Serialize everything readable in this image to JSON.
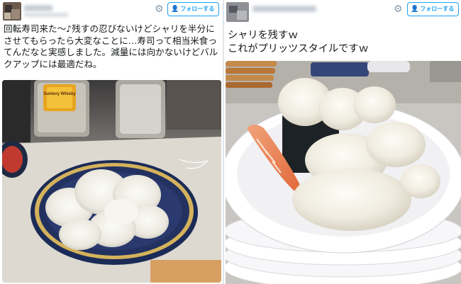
{
  "left_tweet": {
    "follow_label": "フォローする",
    "text": "回転寿司来た～♪残すの忍びないけどシャリを半分にさせてもらったら大変なことに…寿司って相当米食ってんだなと実感しました。減量には向かないけどバルクアップには最適だね。",
    "photo_label": "Suntory Whisky",
    "icons": {
      "settings": "gear-icon",
      "follow": "person-plus-icon"
    }
  },
  "right_tweet": {
    "follow_label": "フォローする",
    "text_line1": "シャリを残すｗ",
    "text_line2": "これがプリッツスタイルですｗ",
    "icons": {
      "settings": "gear-icon",
      "follow": "person-plus-icon"
    }
  },
  "colors": {
    "accent": "#1da1f2",
    "text": "#14171a",
    "muted": "#8899a6"
  }
}
